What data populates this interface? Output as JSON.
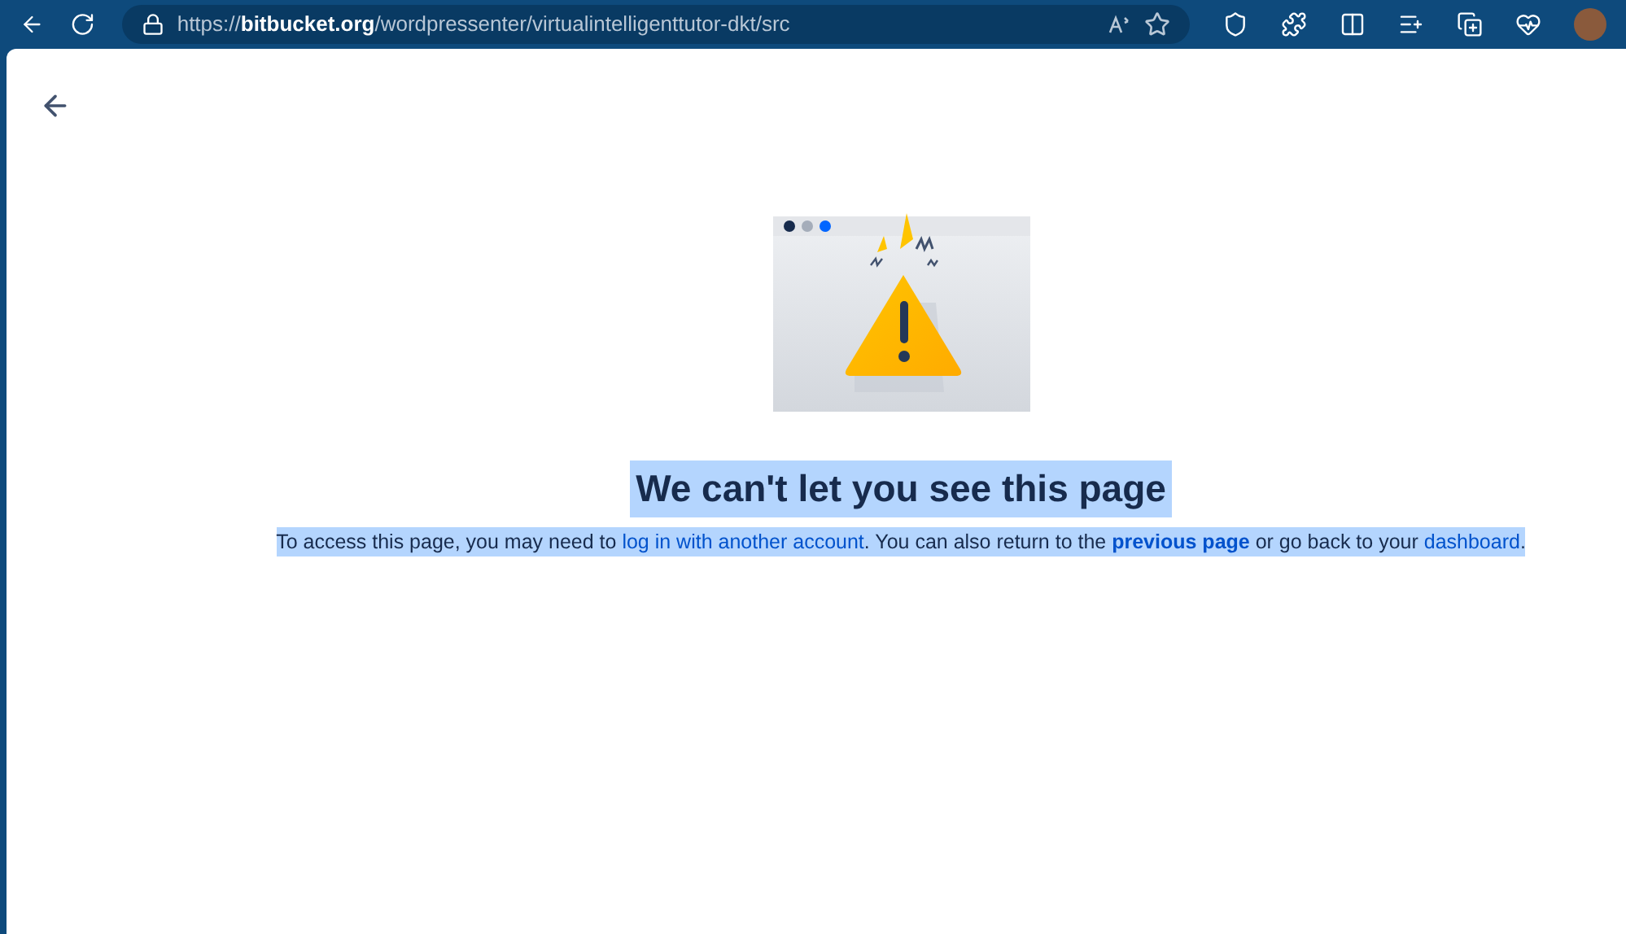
{
  "browser": {
    "url": {
      "scheme": "https://",
      "host": "bitbucket.org",
      "path": "/wordpressenter/virtualintelligenttutor-dkt/src"
    }
  },
  "page": {
    "title": {
      "text": "We can't let you see this page",
      "highlighted": true
    },
    "message": {
      "highlighted": true,
      "parts": [
        {
          "kind": "text",
          "text": "To access this page, you may need to "
        },
        {
          "kind": "link",
          "text": "log in with another account"
        },
        {
          "kind": "text",
          "text": ". You can also return to the "
        },
        {
          "kind": "link",
          "text": "previous page",
          "bold": true
        },
        {
          "kind": "text",
          "text": " or go back to your "
        },
        {
          "kind": "link",
          "text": "dashboard"
        },
        {
          "kind": "text",
          "text": "."
        }
      ]
    }
  }
}
